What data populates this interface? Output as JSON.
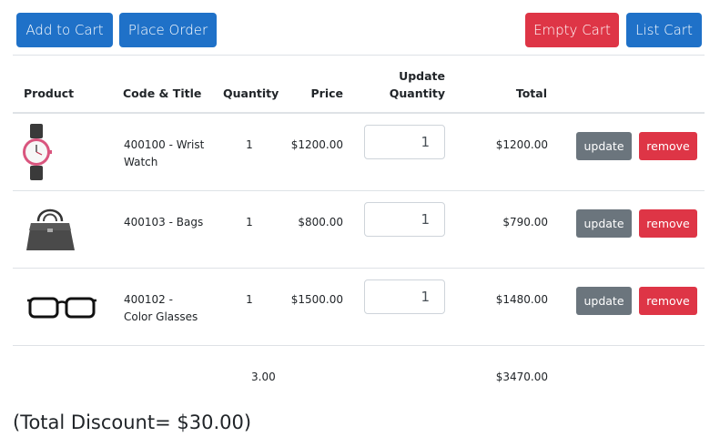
{
  "toolbar": {
    "add_to_cart": "Add to Cart",
    "place_order": "Place Order",
    "empty_cart": "Empty Cart",
    "list_cart": "List Cart"
  },
  "table": {
    "headers": {
      "product": "Product",
      "code_title": "Code & Title",
      "quantity": "Quantity",
      "price": "Price",
      "update_quantity_1": "Update",
      "update_quantity_2": "Quantity",
      "total": "Total"
    },
    "rows": [
      {
        "image": "wrist-watch-icon",
        "code_title_1": "400100 - Wrist",
        "code_title_2": "Watch",
        "quantity": "1",
        "price": "$1200.00",
        "update_qty": "1",
        "total": "$1200.00"
      },
      {
        "image": "handbag-icon",
        "code_title_1": "400103 - Bags",
        "code_title_2": "",
        "quantity": "1",
        "price": "$800.00",
        "update_qty": "1",
        "total": "$790.00"
      },
      {
        "image": "glasses-icon",
        "code_title_1": "400102 -",
        "code_title_2": "Color Glasses",
        "quantity": "1",
        "price": "$1500.00",
        "update_qty": "1",
        "total": "$1480.00"
      }
    ],
    "row_actions": {
      "update": "update",
      "remove": "remove"
    },
    "footer": {
      "quantity_total": "3.00",
      "grand_total": "$3470.00"
    }
  },
  "summary": {
    "total_discount": "(Total Discount=  $30.00)"
  },
  "colors": {
    "primary": "#1f71c8",
    "danger": "#de3546",
    "secondary": "#6b757d"
  }
}
